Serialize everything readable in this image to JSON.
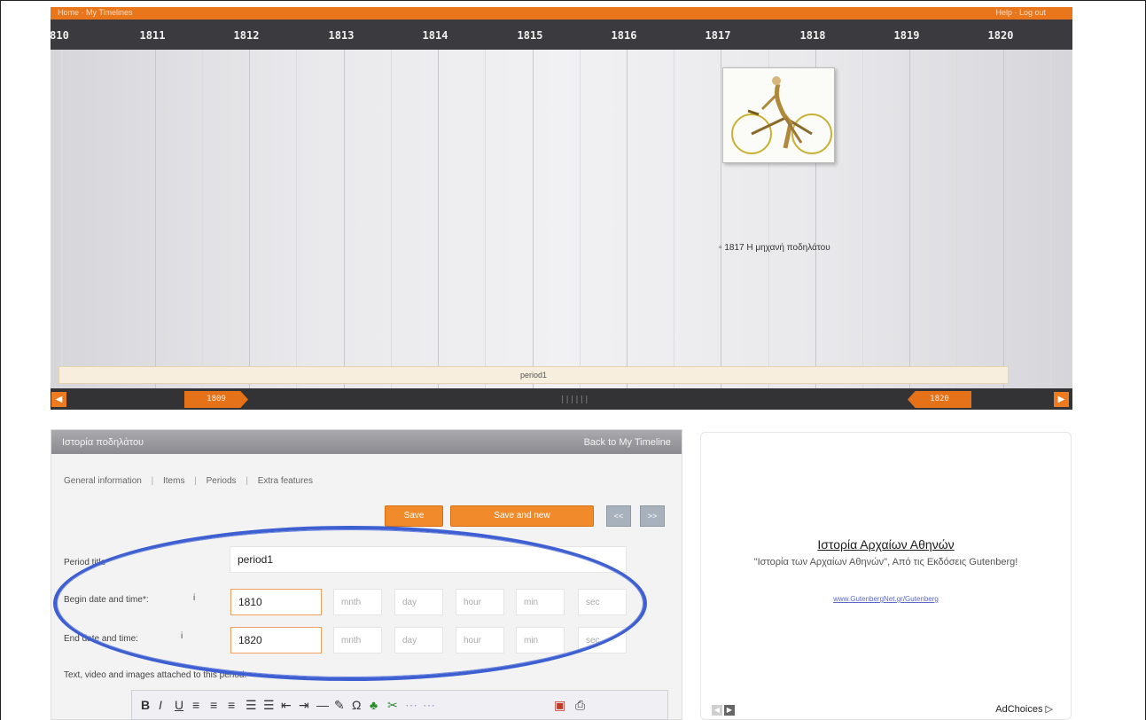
{
  "top_strip": {
    "left_text": "Home  ·  My Timelines",
    "right_text": "Help · Log out"
  },
  "years": [
    "810",
    "1811",
    "1812",
    "1813",
    "1814",
    "1815",
    "1816",
    "1817",
    "1818",
    "1819",
    "1820"
  ],
  "event": {
    "label": "▫ 1817 Η μηχανή ποδηλάτου",
    "image_icon": "draisine-bicycle-icon"
  },
  "period_band": {
    "label": "period1"
  },
  "navigator": {
    "start_label": "1809",
    "end_label": "1820",
    "center_label": "||||||",
    "left_arrow": "◀",
    "right_arrow": "▶"
  },
  "edit_panel": {
    "title": "Ιστορία ποδηλάτου",
    "back_link": "Back to My Timeline",
    "tabs": [
      "General information",
      "Items",
      "Periods",
      "Extra features"
    ],
    "tab_separator": "|",
    "save_button": "Save",
    "save_new_button": "Save and new",
    "small_btn_1": "<<",
    "small_btn_2": ">>",
    "period_title_label": "Period title*",
    "period_title_value": "period1",
    "begin_label": "Begin date and time*:",
    "begin_info": "i",
    "begin_year": "1810",
    "end_label": "End date and time:",
    "end_info": "i",
    "end_year": "1820",
    "placeholders": {
      "month": "mnth",
      "day": "day",
      "hour": "hour",
      "min": "min",
      "sec": "sec"
    },
    "text_label": "Text, video and images attached to this period:"
  },
  "editor_toolbar": [
    "B",
    "I",
    "U",
    "≡",
    "≡",
    "≡",
    "☰",
    "☰",
    "⇤",
    "⇥",
    "—",
    "✎",
    "Ω",
    "♣",
    "✂",
    "⋯",
    "⋯",
    "▣",
    "⎙"
  ],
  "ad": {
    "headline": "Ιστορία Αρχαίων Αθηνών",
    "description": "\"Ιστορία των Αρχαίων Αθηνών\", Από τις Εκδόσεις Gutenberg!",
    "url": "www.GutenbergNet.gr/Gutenberg",
    "prev": "◀",
    "next": "▶",
    "choices": "AdChoices ▷"
  },
  "colors": {
    "accent": "#ee7b1f",
    "dark_bar": "#3b3b3f",
    "ellipse": "#3d5fd1"
  }
}
